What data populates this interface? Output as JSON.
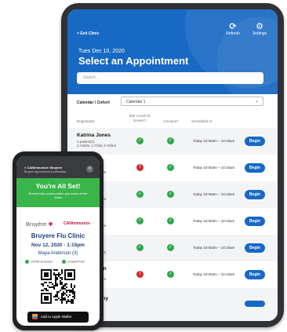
{
  "tablet": {
    "exit_label": "< Exit Clinic",
    "refresh_label": "Refresh",
    "refresh_icon": "refresh-icon",
    "settings_label": "Settings",
    "settings_icon": "gear-icon",
    "date": "Tues Dec 10, 2020",
    "title": "Select an Appointment",
    "search_placeholder": "Search...",
    "calendar_label": "Calendar / Cohort",
    "calendar_value": "Calendar 1",
    "columns": {
      "registrants": "Registrants",
      "screen": "Site Covid-19 Screen?",
      "consent": "Consent?",
      "scheduled": "Scheduled At"
    },
    "rows": [
      {
        "name": "Katrina Jones",
        "sub1": "3 patient(s)",
        "sub2": "2 Adults, 1 Child, 0 Infant",
        "screen": "ok",
        "consent": "ok",
        "time": "Today 10:00am – 10:15am",
        "action": "Begin"
      },
      {
        "name": "off",
        "sub1": "",
        "sub2": "Infant",
        "screen": "bad",
        "consent": "ok",
        "time": "Today 10:00am – 10:15am",
        "action": "Begin"
      },
      {
        "name": "",
        "sub1": "",
        "sub2": "Infant",
        "screen": "ok",
        "consent": "ok",
        "time": "Today 10:00am – 10:15am",
        "action": "Begin"
      },
      {
        "name": "th",
        "sub1": "",
        "sub2": "Infant",
        "screen": "ok",
        "consent": "ok",
        "time": "Today 10:00am – 10:15am",
        "action": "Begin"
      },
      {
        "name": "nc",
        "sub1": "",
        "sub2": "Infant",
        "screen": "ok",
        "consent": "ok",
        "time": "Today 10:00am – 10:15am",
        "action": "Begin"
      },
      {
        "name": "son",
        "sub1": "",
        "sub2": "Infant",
        "screen": "bad",
        "consent": "ok",
        "time": "Today 10:00am – 10:15am",
        "action": "Begin"
      },
      {
        "name": "rphy",
        "sub1": "",
        "sub2": "",
        "screen": "",
        "consent": "",
        "time": "",
        "action": ""
      }
    ],
    "colors": {
      "header": "#1769c4",
      "ok": "#2ea84c",
      "bad": "#d7282f"
    }
  },
  "phone": {
    "top_line1": "< CANImmunize: Bruyère",
    "top_line2": "Bruyere Appointment Confirmation",
    "banner_title": "You're All Set!",
    "banner_sub": "Present this screen when you arrive at the clinic!",
    "brand_left": "Bruyère",
    "brand_right": "CANimmunize",
    "clinic": "Bruyere Flu Clinic",
    "datetime": "Nov 12, 2020 - 1:15pm",
    "patient": "Maya Anderson (3)",
    "chip1": "COVID-19 Screen",
    "chip2": "Consent Form",
    "wallet_label": "Add to Apple Wallet",
    "colors": {
      "banner": "#3ab54a",
      "brand": "#c8102e",
      "text": "#1c3f7a"
    }
  }
}
